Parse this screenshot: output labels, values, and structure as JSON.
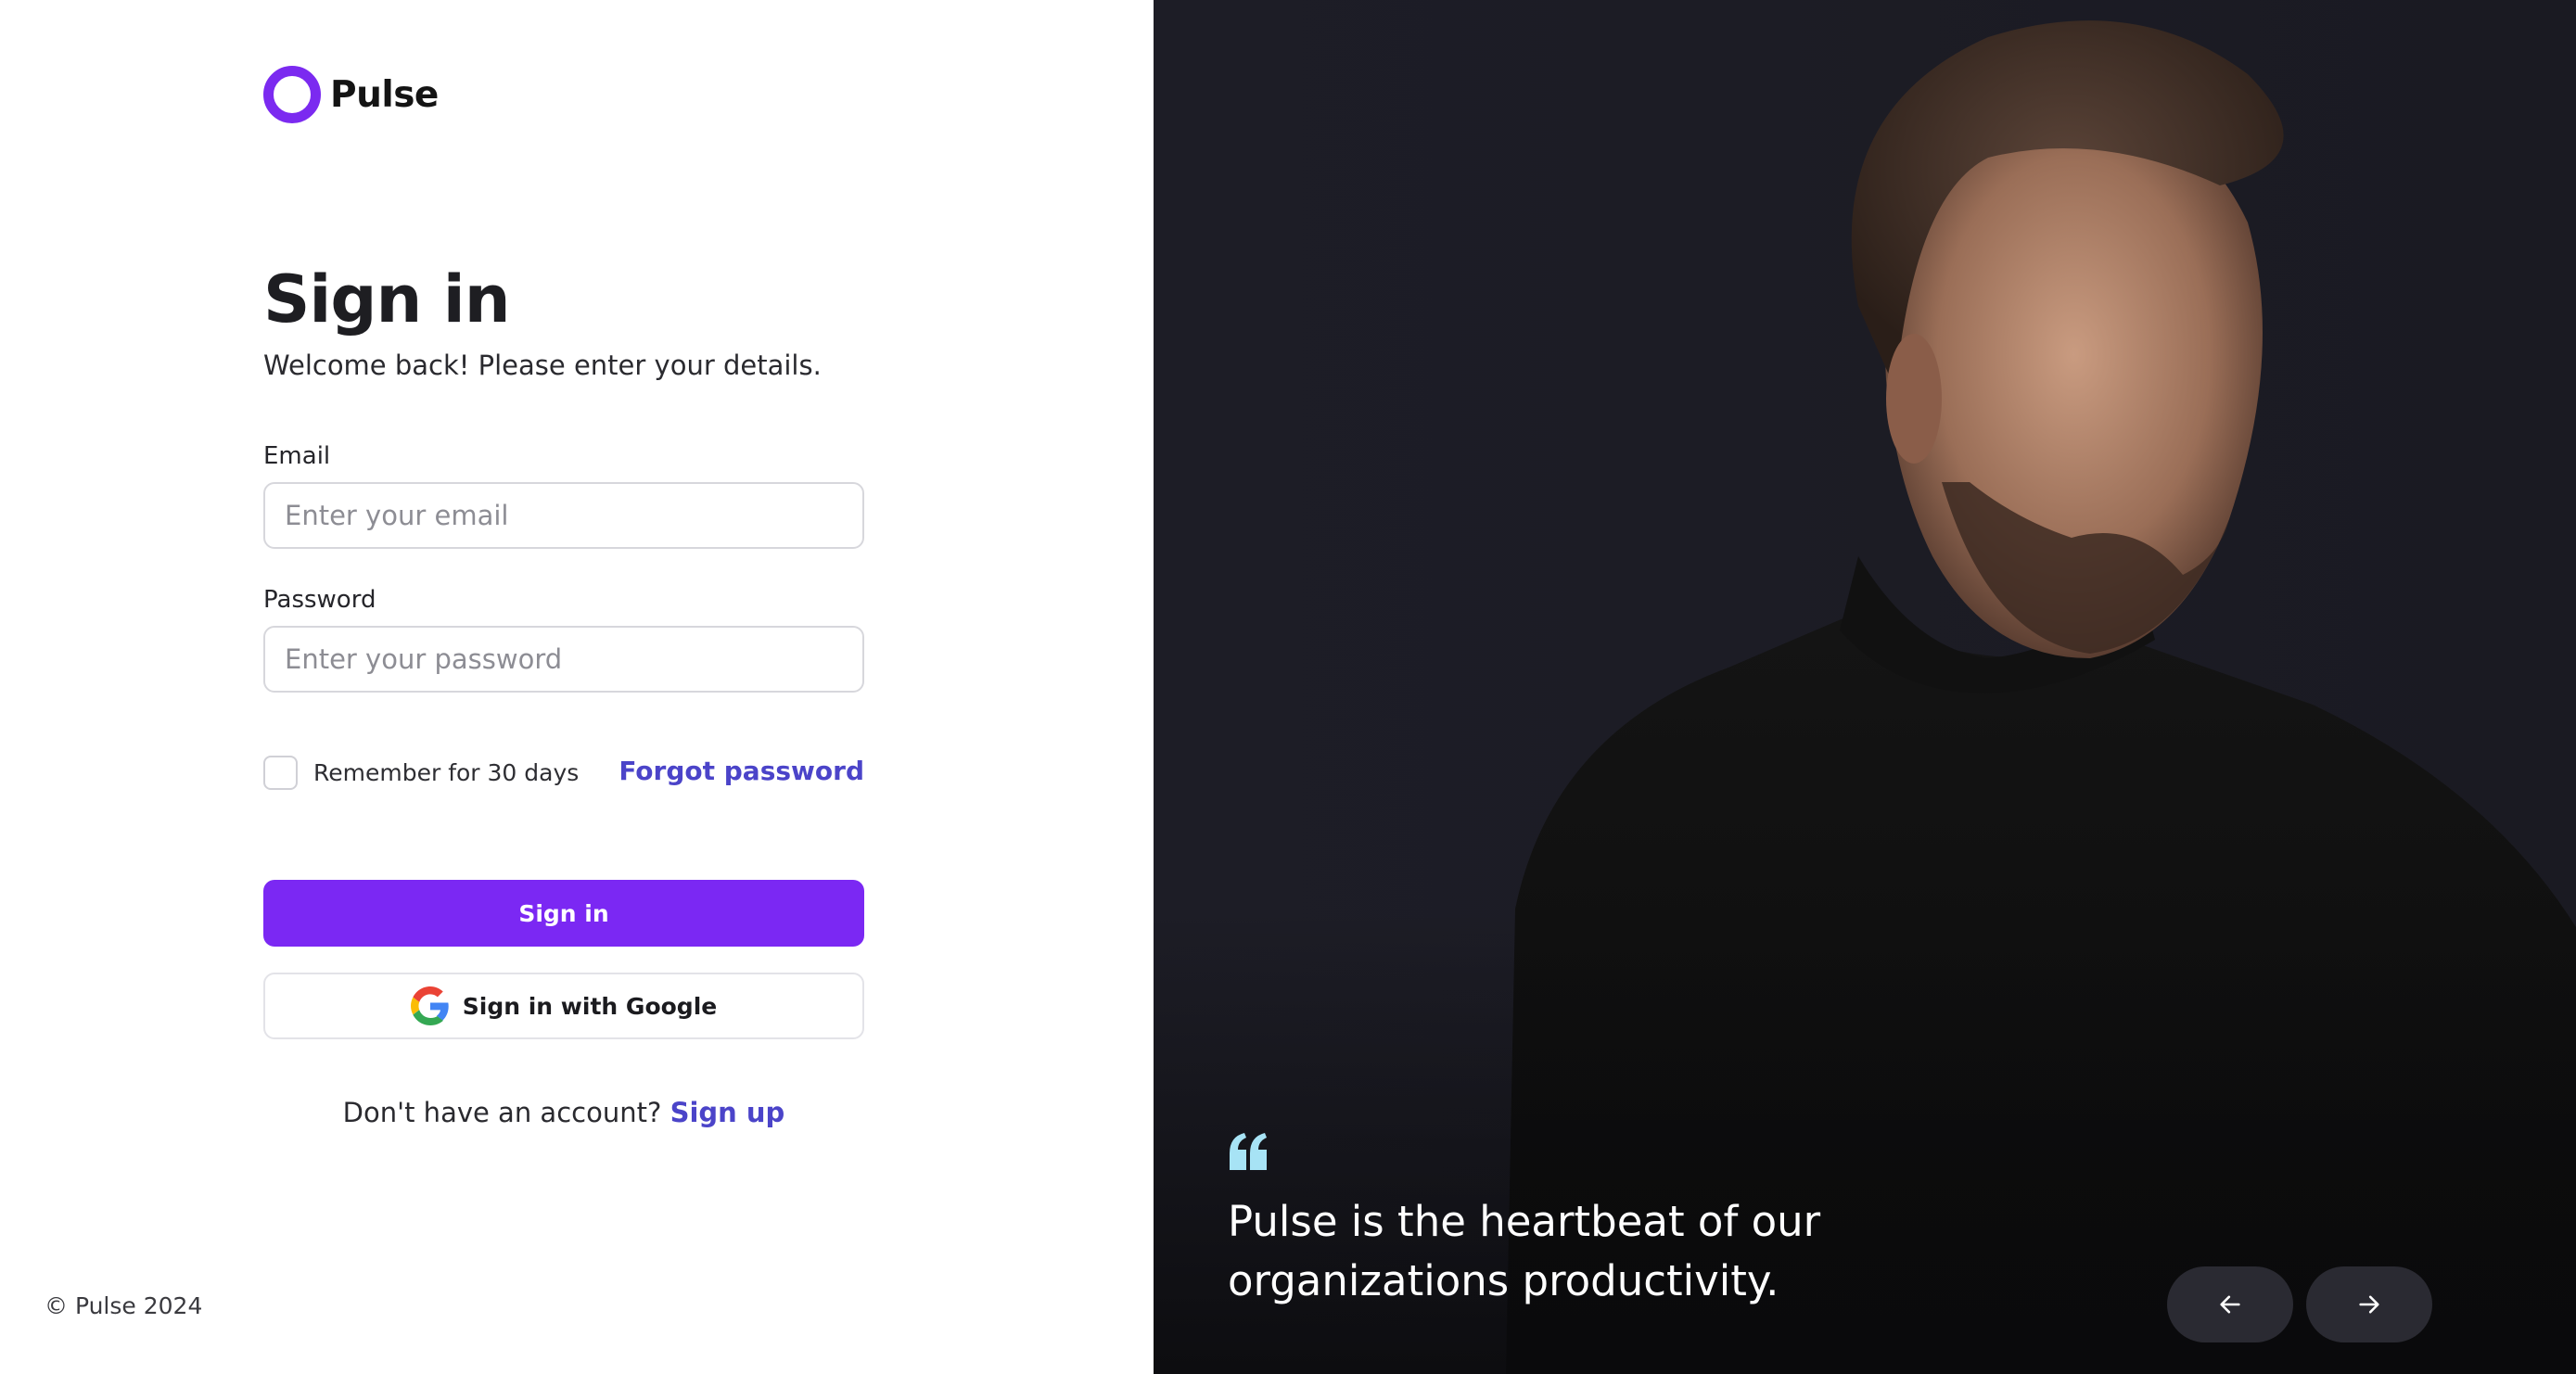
{
  "brand": {
    "name": "Pulse",
    "accent": "#7b2af0"
  },
  "form": {
    "title": "Sign in",
    "subtitle": "Welcome back! Please enter your details.",
    "email_label": "Email",
    "email_placeholder": "Enter your email",
    "password_label": "Password",
    "password_placeholder": "Enter your password",
    "remember_label": "Remember for 30 days",
    "remember_checked": false,
    "forgot_label": "Forgot password",
    "submit_label": "Sign in",
    "google_label": "Sign in with Google",
    "signup_prompt": "Don't have an account?",
    "signup_link": "Sign up"
  },
  "footer": {
    "copyright": "© Pulse 2024"
  },
  "testimonial": {
    "quote": "Pulse is the heartbeat of our organizations productivity.",
    "quote_icon": "quote-icon",
    "prev_icon": "arrow-left-icon",
    "next_icon": "arrow-right-icon"
  },
  "colors": {
    "primary_button": "#7b28f3",
    "link": "#4b44c9",
    "quote_icon": "#a7e3f5",
    "right_panel_bg": "#1c1c25"
  }
}
